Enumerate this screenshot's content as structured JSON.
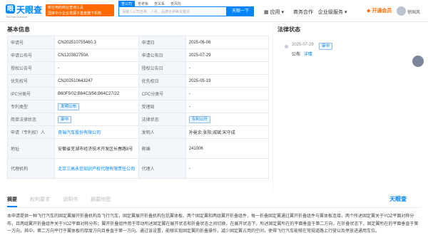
{
  "header": {
    "logo_text": "天眼查",
    "logo_sub": "TianYanCha.com",
    "promo_line1": "新在用的商业查询工具",
    "promo_line2": "国家中小企业发展子基金旗下机构",
    "search_tabs": [
      "查公司",
      "查老板",
      "查关系",
      "查风险"
    ],
    "search_placeholder": "请输入公司名称、人名、品牌名称等关键词",
    "search_button": "天眼一下",
    "nav_app": "应用",
    "nav_items": [
      "商务合作",
      "企业级服务"
    ],
    "vip": "开通会员",
    "username": "徐国风"
  },
  "basic": {
    "title": "基本信息",
    "rows": [
      {
        "k1": "申请号",
        "v1": "CN202510755460.3",
        "k2": "申请日",
        "v2": "2025-06-06"
      },
      {
        "k1": "申请公布号",
        "v1": "CN120382750A",
        "k2": "申请公布日",
        "v2": "2025-07-29"
      },
      {
        "k1": "授权公告号",
        "v1": "-",
        "k2": "授权公告日",
        "v2": "-"
      },
      {
        "k1": "优先权号",
        "v1": "CN202510643247",
        "k2": "优先权日",
        "v2": "2025-05-19"
      },
      {
        "k1": "IPC分类号",
        "v1": "B60F5/02;B64C3/56;B64C27/22",
        "k2": "CPC分类号",
        "v2": "-"
      },
      {
        "k1": "专利类型",
        "v1": "发明公布",
        "k2": "受理局",
        "v2": "-"
      },
      {
        "k1": "简单法律状态",
        "v1": "审中",
        "k2": "法律状态",
        "v2": "专利公开"
      },
      {
        "k1": "申请（专利权）人",
        "v1": "奇瑞汽车股份有限公司",
        "k2": "发明人",
        "v2": "孙曼余;张阳;戚斌;宋守成"
      },
      {
        "k1": "地址",
        "v1": "安徽省芜湖市经济技术开发区长春路8号",
        "k2": "邮编",
        "v2": "241006"
      },
      {
        "k1": "代理机构",
        "v1": "北京三高永信知识产权代理有限责任公司",
        "k2": "代理人",
        "v2": "-"
      }
    ]
  },
  "legal": {
    "title": "法律状态",
    "date": "2025-07-29",
    "badge": "审中",
    "event": "公布",
    "detail": "详情"
  },
  "abstract": {
    "tabs": [
      "摘要",
      "权利要求",
      "说明书",
      "摘要附图"
    ],
    "brand": "天眼查",
    "text": "本申请提供一种飞行汽车的固定翼展开折叠机构及飞行汽车，固定翼展开折叠机构包括翼体板、两个固定翼和两组翼开折叠组件，每一折叠固定翼通过翼开折叠组件与翼体板连接，两个所述固定翼关于YOZ平面对称分布，且两组翼开折叠组件关于YOZ平面对称分布；翼开折叠组件用于带动所述固定翼在展开状态和折叠状态之间切换，在展开状态下，所述固定翼所在的平面垂直于第二方向，在折叠状态下，固定翼所在的平面垂直于第一方向，其中，第二方向平行于翼体板的厚度方向且垂直于第一方向。通过该设置，能够实现固定翼的折叠操作，减少固定翼占用的空间，使得飞行汽车能够在常规道路上行驶以及停放进通用车位。"
  }
}
